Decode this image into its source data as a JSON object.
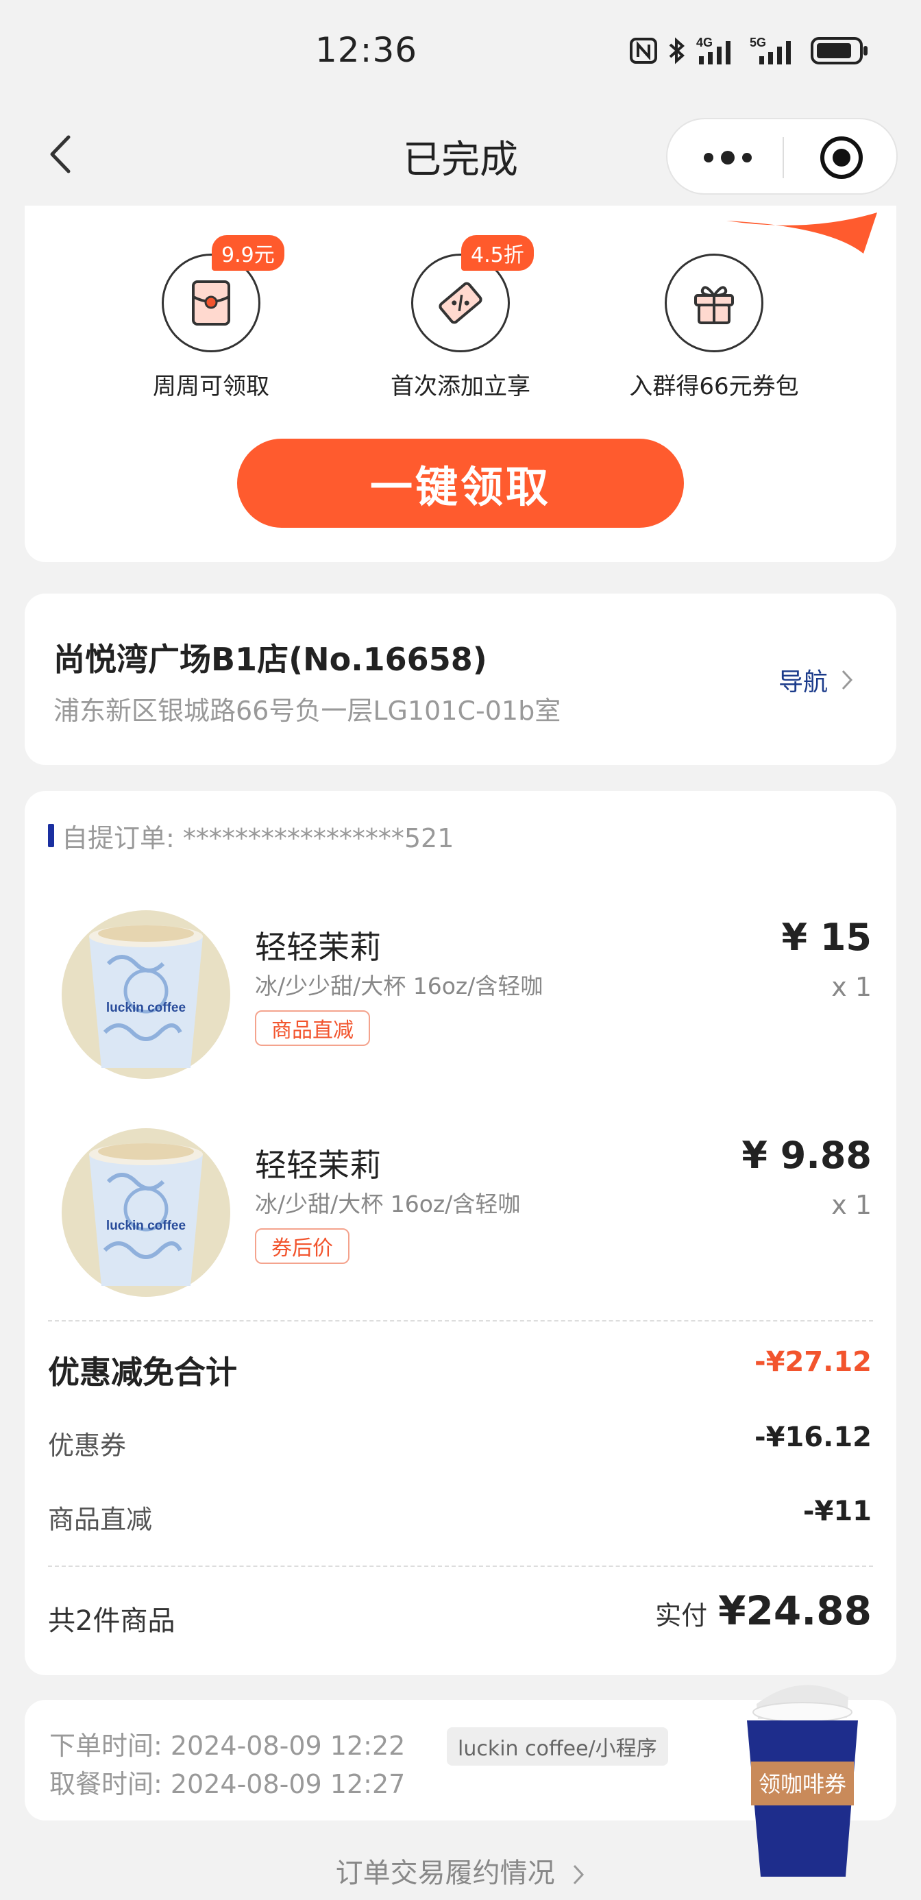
{
  "status_bar": {
    "time": "12:36",
    "icons": [
      "nfc-icon",
      "bluetooth-icon",
      "4g-signal-icon",
      "5g-signal-icon",
      "battery-icon"
    ],
    "network_labels": [
      "4G",
      "5G"
    ]
  },
  "nav": {
    "title": "已完成",
    "back_icon": "chevron-left-icon",
    "more_icon": "more-dots-icon",
    "close_icon": "target-icon"
  },
  "promo": {
    "benefits": [
      {
        "label": "周周可领取",
        "badge": "9.9元",
        "icon": "red-packet-icon"
      },
      {
        "label": "首次添加立享",
        "badge": "4.5折",
        "icon": "coupon-ticket-icon"
      },
      {
        "label": "入群得66元券包",
        "badge": "",
        "icon": "gift-icon"
      }
    ],
    "claim_button": "一键领取",
    "accent_color": "#ff5b2e"
  },
  "store": {
    "name": "尚悦湾广场B1店(No.16658)",
    "address": "浦东新区银城路66号负一层LG101C-01b室",
    "nav_link": "导航"
  },
  "order": {
    "label": "自提订单: *****************521",
    "items": [
      {
        "name": "轻轻茉莉",
        "spec": "冰/少少甜/大杯 16oz/含轻咖",
        "tag": "商品直减",
        "price": "¥ 15",
        "qty": "x 1",
        "cup_text": "luckin coffee"
      },
      {
        "name": "轻轻茉莉",
        "spec": "冰/少甜/大杯 16oz/含轻咖",
        "tag": "券后价",
        "price": "¥ 9.88",
        "qty": "x 1",
        "cup_text": "luckin coffee"
      }
    ],
    "discount_total_label": "优惠减免合计",
    "discount_total_value": "-¥27.12",
    "coupon_label": "优惠券",
    "coupon_value": "-¥16.12",
    "direct_label": "商品直减",
    "direct_value": "-¥11",
    "count_label": "共2件商品",
    "paid_label": "实付",
    "paid_value": "¥24.88"
  },
  "times": {
    "order_time": "下单时间:  2024-08-09 12:22",
    "pickup_time": "取餐时间:  2024-08-09 12:27",
    "channel": "luckin coffee/小程序"
  },
  "floating_coupon": {
    "label": "领咖啡券"
  },
  "footer": {
    "link": "订单交易履约情况"
  }
}
